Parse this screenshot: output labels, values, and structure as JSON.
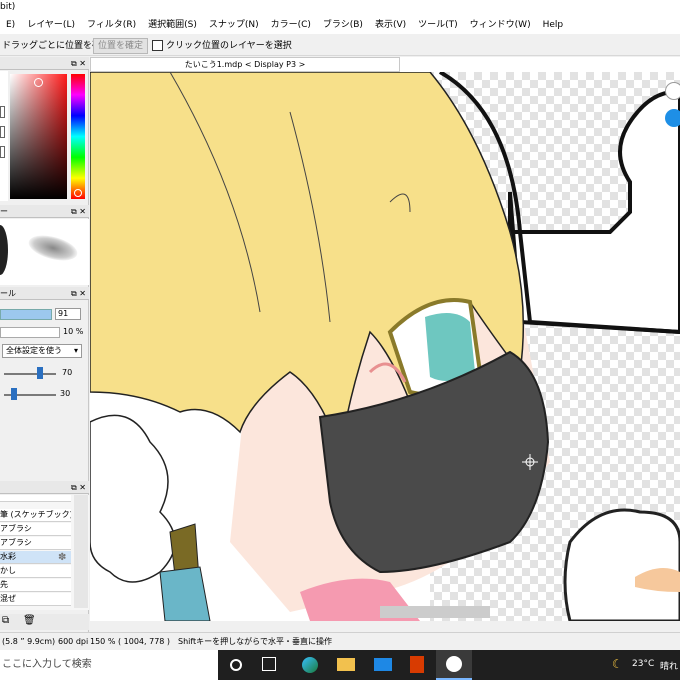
{
  "window": {
    "title_fragment": "bit)"
  },
  "menu": [
    "E)",
    "レイヤー(L)",
    "フィルタ(R)",
    "選択範囲(S)",
    "スナップ(N)",
    "カラー(C)",
    "ブラシ(B)",
    "表示(V)",
    "ツール(T)",
    "ウィンドウ(W)",
    "Help"
  ],
  "toolbar": {
    "drag_label": "ドラッグごとに位置を確定",
    "confirm_button": "位置を確定",
    "click_select_label": "クリック位置のレイヤーを選択"
  },
  "document_tab": "たいこう1.mdp < Display P3 >",
  "left_panel": {
    "brush_panel_head": "ー",
    "tool_panel_head": "ール",
    "size_value": "91",
    "opacity_value": "10 %",
    "mode_select": "全体設定を使う",
    "slider1_value": "70",
    "slider2_value": "30",
    "brush_list": [
      "筆 (スケッチブック)",
      "アブラシ",
      "アブラシ",
      "水彩",
      "かし",
      "先",
      "混ぜ"
    ],
    "selected_index": 3
  },
  "status": {
    "size": "(5.8 ” 9.9cm)",
    "dpi": "600 dpi",
    "zoom": "150 %",
    "coords": "( 1004, 778 )",
    "hint": "Shiftキーを押しながらで水平・垂直に操作"
  },
  "taskbar": {
    "search_placeholder": "ここに入力して検索",
    "temperature": "23°C",
    "weather": "晴れ"
  },
  "colors": {
    "hair": "#f7e08a",
    "mask": "#4a4a4a",
    "eye": "#6ec7c0",
    "skin": "#fce6dc",
    "accent_blue": "#1e8fe6"
  }
}
